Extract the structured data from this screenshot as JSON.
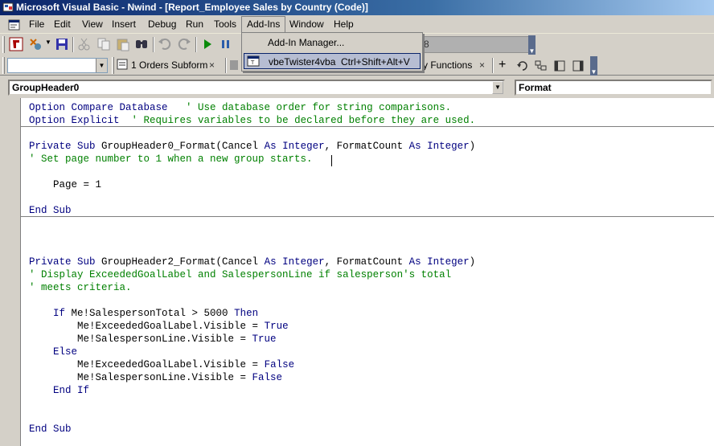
{
  "window": {
    "title": "Microsoft Visual Basic - Nwind - [Report_Employee Sales by Country (Code)]"
  },
  "menubar": {
    "items": [
      {
        "label": "File",
        "accel": "F"
      },
      {
        "label": "Edit",
        "accel": "E"
      },
      {
        "label": "View",
        "accel": "V"
      },
      {
        "label": "Insert",
        "accel": "I"
      },
      {
        "label": "Debug",
        "accel": "D"
      },
      {
        "label": "Run",
        "accel": "R"
      },
      {
        "label": "Tools",
        "accel": "T"
      },
      {
        "label": "Add-Ins",
        "accel": "A"
      },
      {
        "label": "Window",
        "accel": "W"
      },
      {
        "label": "Help",
        "accel": "H"
      }
    ]
  },
  "addins_menu": {
    "items": [
      {
        "label": "Add-In Manager...",
        "shortcut": ""
      },
      {
        "label": "vbeTwister4vba",
        "shortcut": "Ctrl+Shift+Alt+V"
      }
    ]
  },
  "toolbar1": {
    "partial_text": "8"
  },
  "toolbar2": {
    "tab1_label": "1 Orders Subform",
    "tab2_label": "y Functions",
    "close_glyph": "×"
  },
  "object_combo": {
    "value": "GroupHeader0"
  },
  "procedure_combo": {
    "value": "Format"
  },
  "code": [
    [
      {
        "t": "Option Compare Database",
        "c": "kw"
      },
      {
        "t": "   ' Use database order for string comparisons.",
        "c": "cm"
      }
    ],
    [
      {
        "t": "Option Explicit",
        "c": "kw"
      },
      {
        "t": "  ' Requires variables to be declared before they are used.",
        "c": "cm"
      }
    ],
    [],
    [
      {
        "t": "Private Sub ",
        "c": "kw"
      },
      {
        "t": "GroupHeader0_Format(Cancel ",
        "c": "tx"
      },
      {
        "t": "As Integer",
        "c": "kw"
      },
      {
        "t": ", FormatCount ",
        "c": "tx"
      },
      {
        "t": "As Integer",
        "c": "kw"
      },
      {
        "t": ")",
        "c": "tx"
      }
    ],
    [
      {
        "t": "' Set page number to 1 when a new group starts.",
        "c": "cm"
      }
    ],
    [],
    [
      {
        "t": "    Page = 1",
        "c": "tx"
      }
    ],
    [],
    [
      {
        "t": "End Sub",
        "c": "kw"
      }
    ],
    [],
    [],
    [],
    [
      {
        "t": "Private Sub ",
        "c": "kw"
      },
      {
        "t": "GroupHeader2_Format(Cancel ",
        "c": "tx"
      },
      {
        "t": "As Integer",
        "c": "kw"
      },
      {
        "t": ", FormatCount ",
        "c": "tx"
      },
      {
        "t": "As Integer",
        "c": "kw"
      },
      {
        "t": ")",
        "c": "tx"
      }
    ],
    [
      {
        "t": "' Display ExceededGoalLabel and SalespersonLine if salesperson's total",
        "c": "cm"
      }
    ],
    [
      {
        "t": "' meets criteria.",
        "c": "cm"
      }
    ],
    [],
    [
      {
        "t": "    ",
        "c": "tx"
      },
      {
        "t": "If ",
        "c": "kw"
      },
      {
        "t": "Me!SalespersonTotal > 5000 ",
        "c": "tx"
      },
      {
        "t": "Then",
        "c": "kw"
      }
    ],
    [
      {
        "t": "        Me!ExceededGoalLabel.Visible = ",
        "c": "tx"
      },
      {
        "t": "True",
        "c": "kw"
      }
    ],
    [
      {
        "t": "        Me!SalespersonLine.Visible = ",
        "c": "tx"
      },
      {
        "t": "True",
        "c": "kw"
      }
    ],
    [
      {
        "t": "    ",
        "c": "tx"
      },
      {
        "t": "Else",
        "c": "kw"
      }
    ],
    [
      {
        "t": "        Me!ExceededGoalLabel.Visible = ",
        "c": "tx"
      },
      {
        "t": "False",
        "c": "kw"
      }
    ],
    [
      {
        "t": "        Me!SalespersonLine.Visible = ",
        "c": "tx"
      },
      {
        "t": "False",
        "c": "kw"
      }
    ],
    [
      {
        "t": "    ",
        "c": "tx"
      },
      {
        "t": "End If",
        "c": "kw"
      }
    ],
    [],
    [],
    [
      {
        "t": "End Sub",
        "c": "kw"
      }
    ]
  ]
}
